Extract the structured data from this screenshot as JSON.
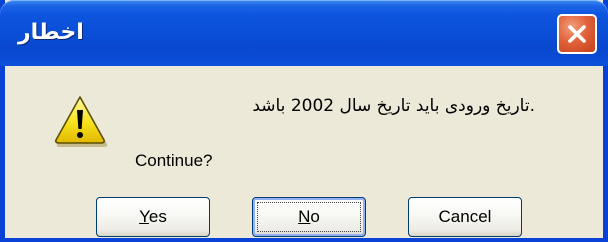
{
  "window": {
    "title": "اخطار",
    "close_icon": "close-icon",
    "accent": "#0842d6",
    "close_color": "#e2623a"
  },
  "dialog": {
    "icon": "warning-icon",
    "message": ".تاریخ ورودی باید تاریخ سال 2002 باشد",
    "prompt": "Continue?"
  },
  "buttons": {
    "yes": {
      "accel": "Y",
      "rest": "es"
    },
    "no": {
      "accel": "N",
      "rest": "o",
      "focused": true
    },
    "cancel": {
      "label": "Cancel"
    }
  }
}
